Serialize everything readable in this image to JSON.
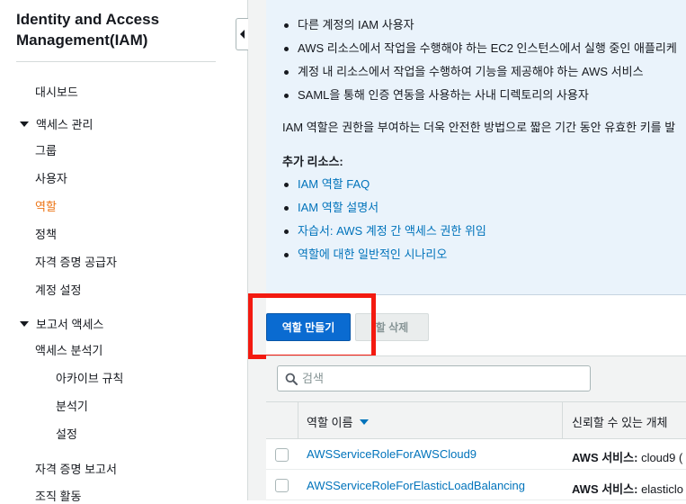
{
  "sidebar": {
    "title": "Identity and Access Management(IAM)",
    "dashboard": "대시보드",
    "access_management": {
      "label": "액세스 관리",
      "items": [
        "그룹",
        "사용자",
        "역할",
        "정책",
        "자격 증명 공급자",
        "계정 설정"
      ],
      "active": "역할"
    },
    "report_access": {
      "label": "보고서 액세스",
      "analyzer": "액세스 분석기",
      "sub_items": [
        "아카이브 규칙",
        "분석기",
        "설정"
      ],
      "items": [
        "자격 증명 보고서",
        "조직 활동"
      ]
    }
  },
  "info": {
    "bullets": [
      "다른 계정의 IAM 사용자",
      "AWS 리소스에서 작업을 수행해야 하는 EC2 인스턴스에서 실행 중인 애플리케",
      "계정 내 리소스에서 작업을 수행하여 기능을 제공해야 하는 AWS 서비스",
      "SAML을 통해 인증 연동을 사용하는 사내 디렉토리의 사용자"
    ],
    "paragraph": "IAM 역할은 권한을 부여하는 더욱 안전한 방법으로 짧은 기간 동안 유효한 키를 발",
    "resources_heading": "추가 리소스:",
    "links": [
      "IAM 역할 FAQ",
      "IAM 역할 설명서",
      "자습서: AWS 계정 간 액세스 권한 위임",
      "역할에 대한 일반적인 시나리오"
    ]
  },
  "actions": {
    "create_role": "역할 만들기",
    "delete_role": "할 삭제"
  },
  "search": {
    "placeholder": "검색"
  },
  "table": {
    "columns": [
      "역할 이름",
      "신뢰할 수 있는 개체"
    ],
    "rows": [
      {
        "name": "AWSServiceRoleForAWSCloud9",
        "trust_label": "AWS 서비스:",
        "trust_value": "cloud9 ("
      },
      {
        "name": "AWSServiceRoleForElasticLoadBalancing",
        "trust_label": "AWS 서비스:",
        "trust_value": "elasticlo"
      }
    ]
  },
  "colors": {
    "accent_active": "#ec7211",
    "link": "#0073bb",
    "primary_button": "#0a6bd1",
    "highlight": "#f31a10",
    "info_bg": "#eaf3fb"
  }
}
